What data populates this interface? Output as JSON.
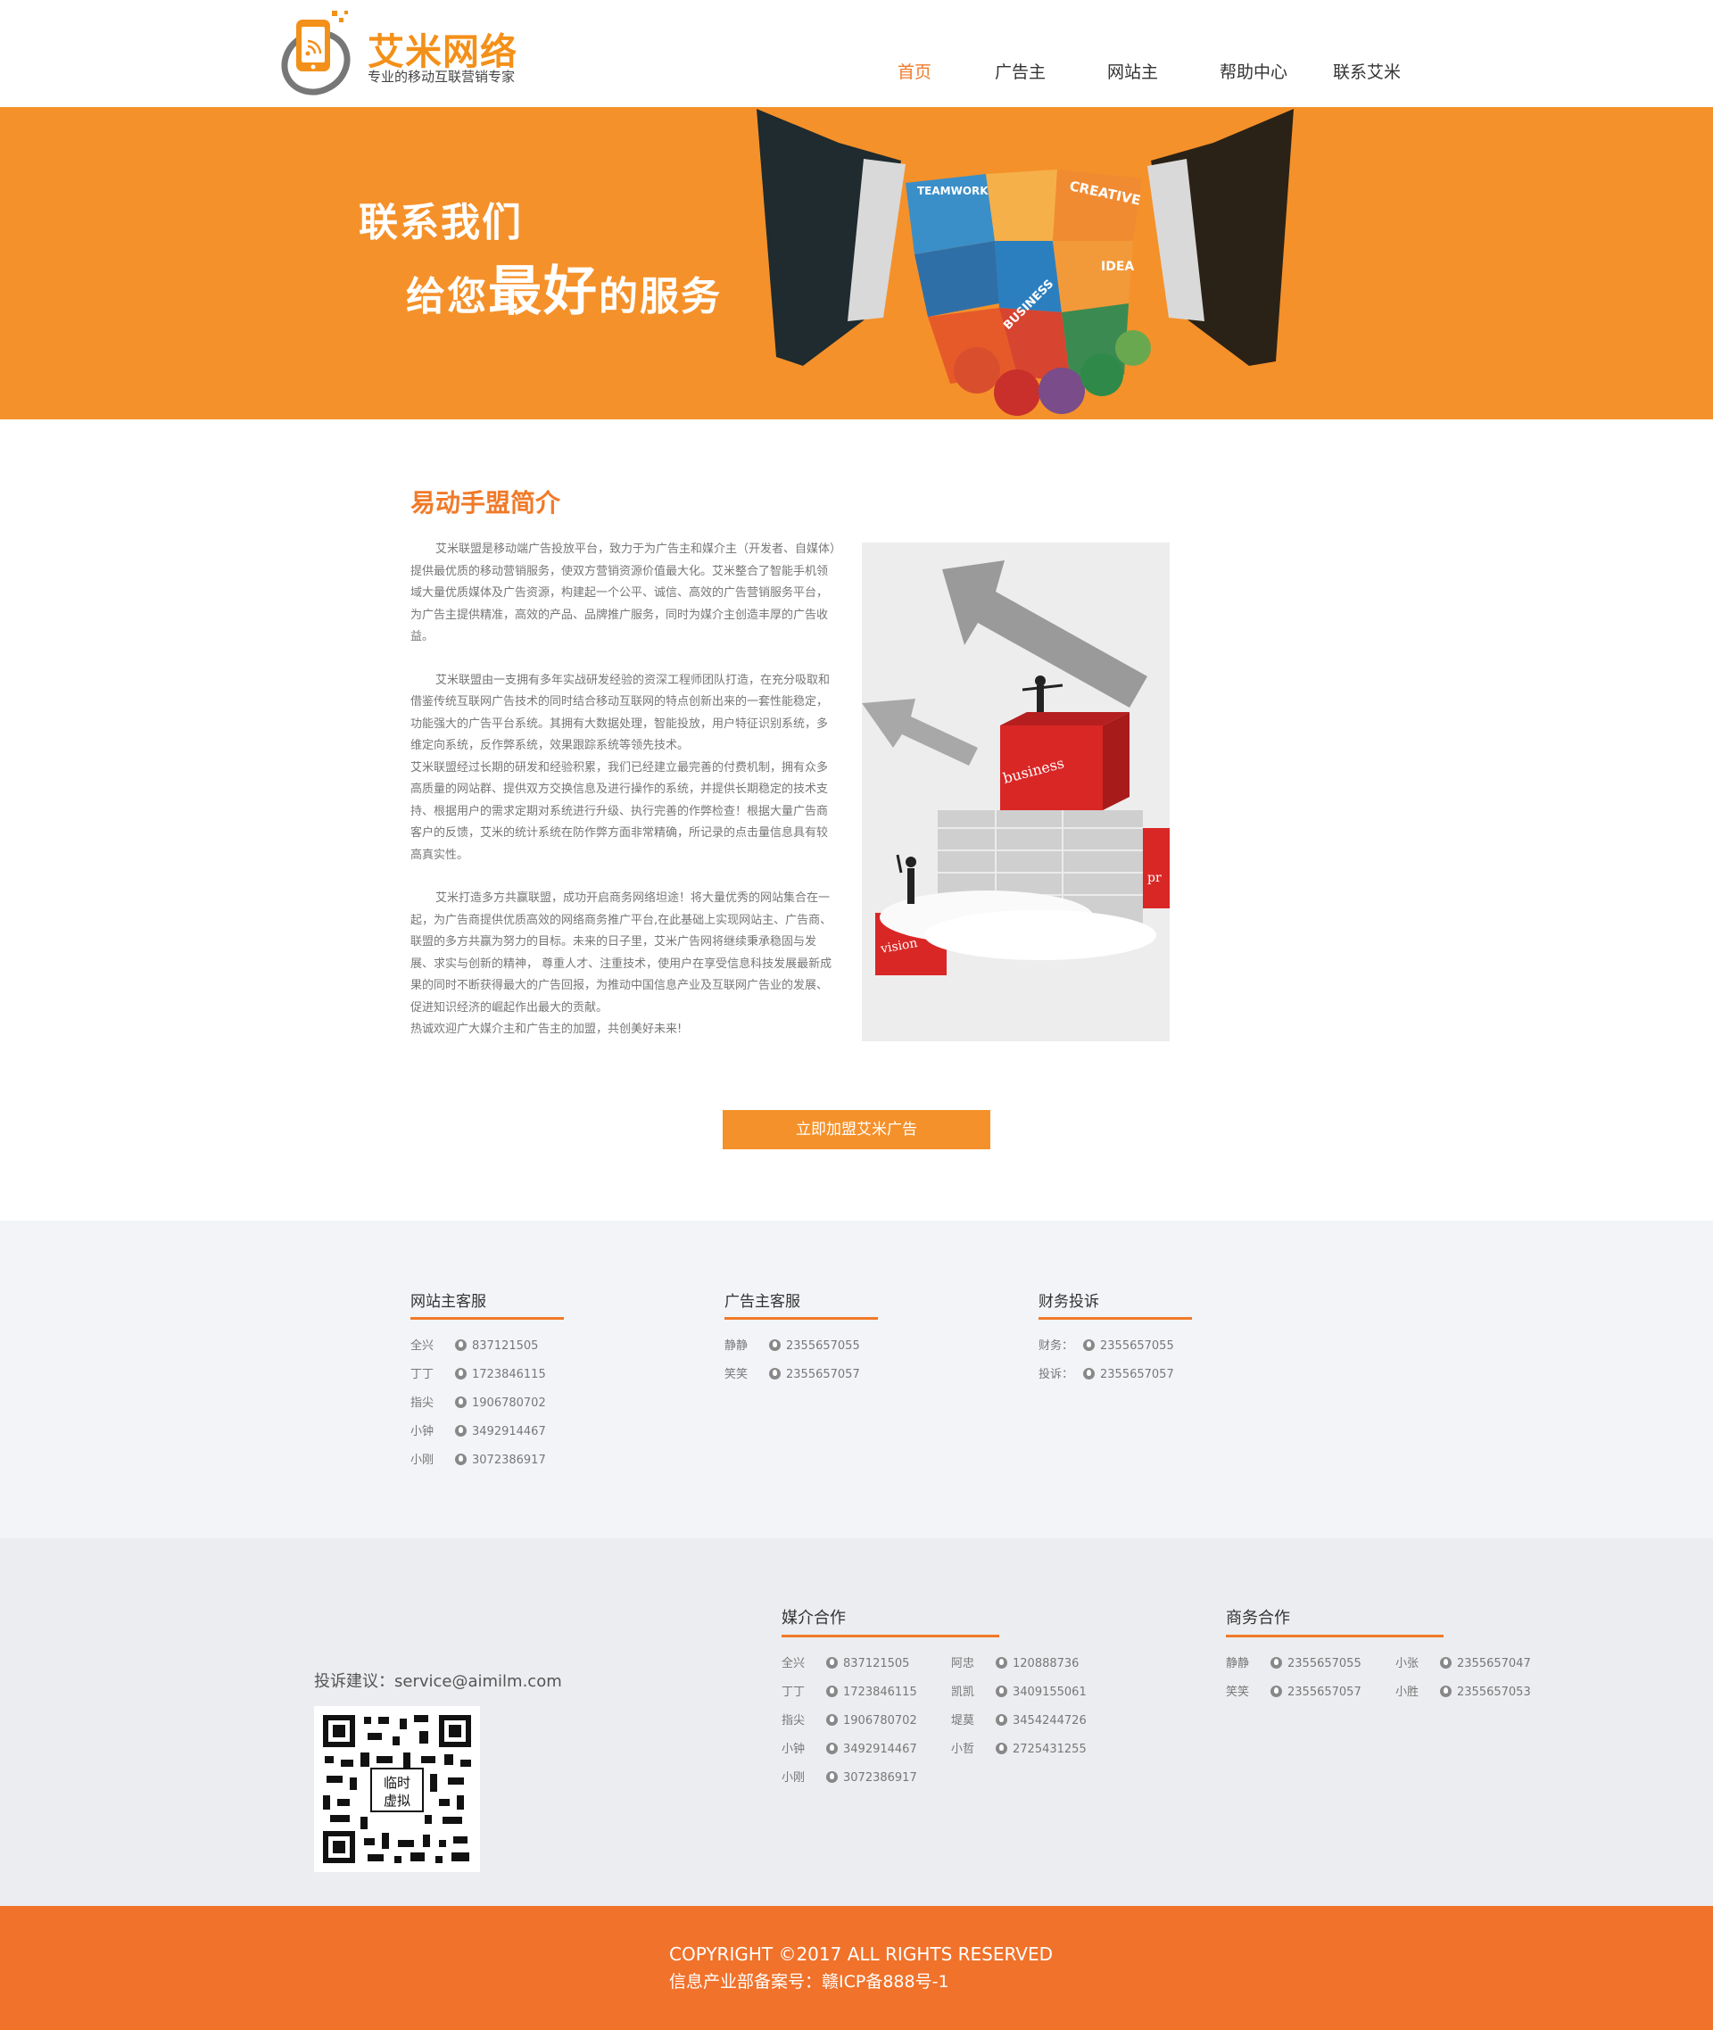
{
  "header": {
    "logo_name": "艾米网络",
    "logo_slogan": "专业的移动互联营销专家",
    "nav": [
      "首页",
      "广告主",
      "网站主",
      "帮助中心",
      "联系艾米"
    ],
    "active_nav": "首页"
  },
  "banner": {
    "line1": "联系我们",
    "line2_pre": "给您",
    "line2_big": "最好",
    "line2_post": "的服务",
    "art_words": [
      "TEAMWORK",
      "CREATIVE",
      "IDEA",
      "BUSINESS"
    ]
  },
  "intro": {
    "title": "易动手盟简介",
    "paragraphs": [
      "艾米联盟是移动端广告投放平台，致力于为广告主和媒介主（开发者、自媒体）提供最优质的移动营销服务，使双方营销资源价值最大化。艾米整合了智能手机领域大量优质媒体及广告资源，构建起一个公平、诚信、高效的广告营销服务平台，为广告主提供精准，高效的产品、品牌推广服务，同时为媒介主创造丰厚的广告收益。",
      "艾米联盟由一支拥有多年实战研发经验的资深工程师团队打造，在充分吸取和借鉴传统互联网广告技术的同时结合移动互联网的特点创新出来的一套性能稳定，功能强大的广告平台系统。其拥有大数据处理，智能投放，用户特征识别系统，多维定向系统，反作弊系统，效果跟踪系统等领先技术。",
      "艾米联盟经过长期的研发和经验积累，我们已经建立最完善的付费机制，拥有众多高质量的网站群、提供双方交换信息及进行操作的系统，并提供长期稳定的技术支持、根据用户的需求定期对系统进行升级、执行完善的作弊检查！根据大量广告商客户的反馈，艾米的统计系统在防作弊方面非常精确，所记录的点击量信息具有较高真实性。",
      "艾米打造多方共赢联盟，成功开启商务网络坦途！将大量优秀的网站集合在一起，为广告商提供优质高效的网络商务推广平台,在此基础上实现网站主、广告商、联盟的多方共赢为努力的目标。未来的日子里，艾米广告网将继续秉承稳固与发展、求实与创新的精神， 尊重人才、注重技术，使用户在享受信息科技发展最新成果的同时不断获得最大的广告回报，为推动中国信息产业及互联网广告业的发展、促进知识经济的崛起作出最大的贡献。",
      "热诚欢迎广大媒介主和广告主的加盟，共创美好未来!"
    ],
    "image_words": [
      "business",
      "vision",
      "pr"
    ]
  },
  "join_button": "立即加盟艾米广告",
  "service": {
    "columns": [
      {
        "title": "网站主客服",
        "contacts": [
          {
            "name": "全兴",
            "qq": "837121505"
          },
          {
            "name": "丁丁",
            "qq": "1723846115"
          },
          {
            "name": "指尖",
            "qq": "1906780702"
          },
          {
            "name": "小钟",
            "qq": "3492914467"
          },
          {
            "name": "小刚",
            "qq": "3072386917"
          }
        ]
      },
      {
        "title": "广告主客服",
        "contacts": [
          {
            "name": "静静",
            "qq": "2355657055"
          },
          {
            "name": "笑笑",
            "qq": "2355657057"
          }
        ]
      },
      {
        "title": "财务投诉",
        "contacts": [
          {
            "name": "财务：",
            "qq": "2355657055"
          },
          {
            "name": "投诉：",
            "qq": "2355657057"
          }
        ]
      }
    ]
  },
  "footer": {
    "complaint": "投诉建议：service@aimilm.com",
    "qr_text": [
      "临时",
      "虚拟"
    ],
    "media": {
      "title": "媒介合作",
      "list1": [
        {
          "name": "全兴",
          "qq": "837121505"
        },
        {
          "name": "丁丁",
          "qq": "1723846115"
        },
        {
          "name": "指尖",
          "qq": "1906780702"
        },
        {
          "name": "小钟",
          "qq": "3492914467"
        },
        {
          "name": "小刚",
          "qq": "3072386917"
        }
      ],
      "list2": [
        {
          "name": "阿忠",
          "qq": "120888736"
        },
        {
          "name": "凯凯",
          "qq": "3409155061"
        },
        {
          "name": "堤莫",
          "qq": "3454244726"
        },
        {
          "name": "小哲",
          "qq": "2725431255"
        }
      ]
    },
    "business": {
      "title": "商务合作",
      "list1": [
        {
          "name": "静静",
          "qq": "2355657055"
        },
        {
          "name": "笑笑",
          "qq": "2355657057"
        }
      ],
      "list2": [
        {
          "name": "小张",
          "qq": "2355657047"
        },
        {
          "name": "小胜",
          "qq": "2355657053"
        }
      ]
    },
    "copyright": "COPYRIGHT ©2017 ALL RIGHTS RESERVED",
    "icp": "信息产业部备案号：赣ICP备888号-1"
  },
  "colors": {
    "brand_orange": "#f5912a",
    "accent_orange": "#f07a29",
    "footer_orange": "#f1722a",
    "service_bg": "#f3f4f8",
    "footer_bg": "#ecedf0"
  }
}
